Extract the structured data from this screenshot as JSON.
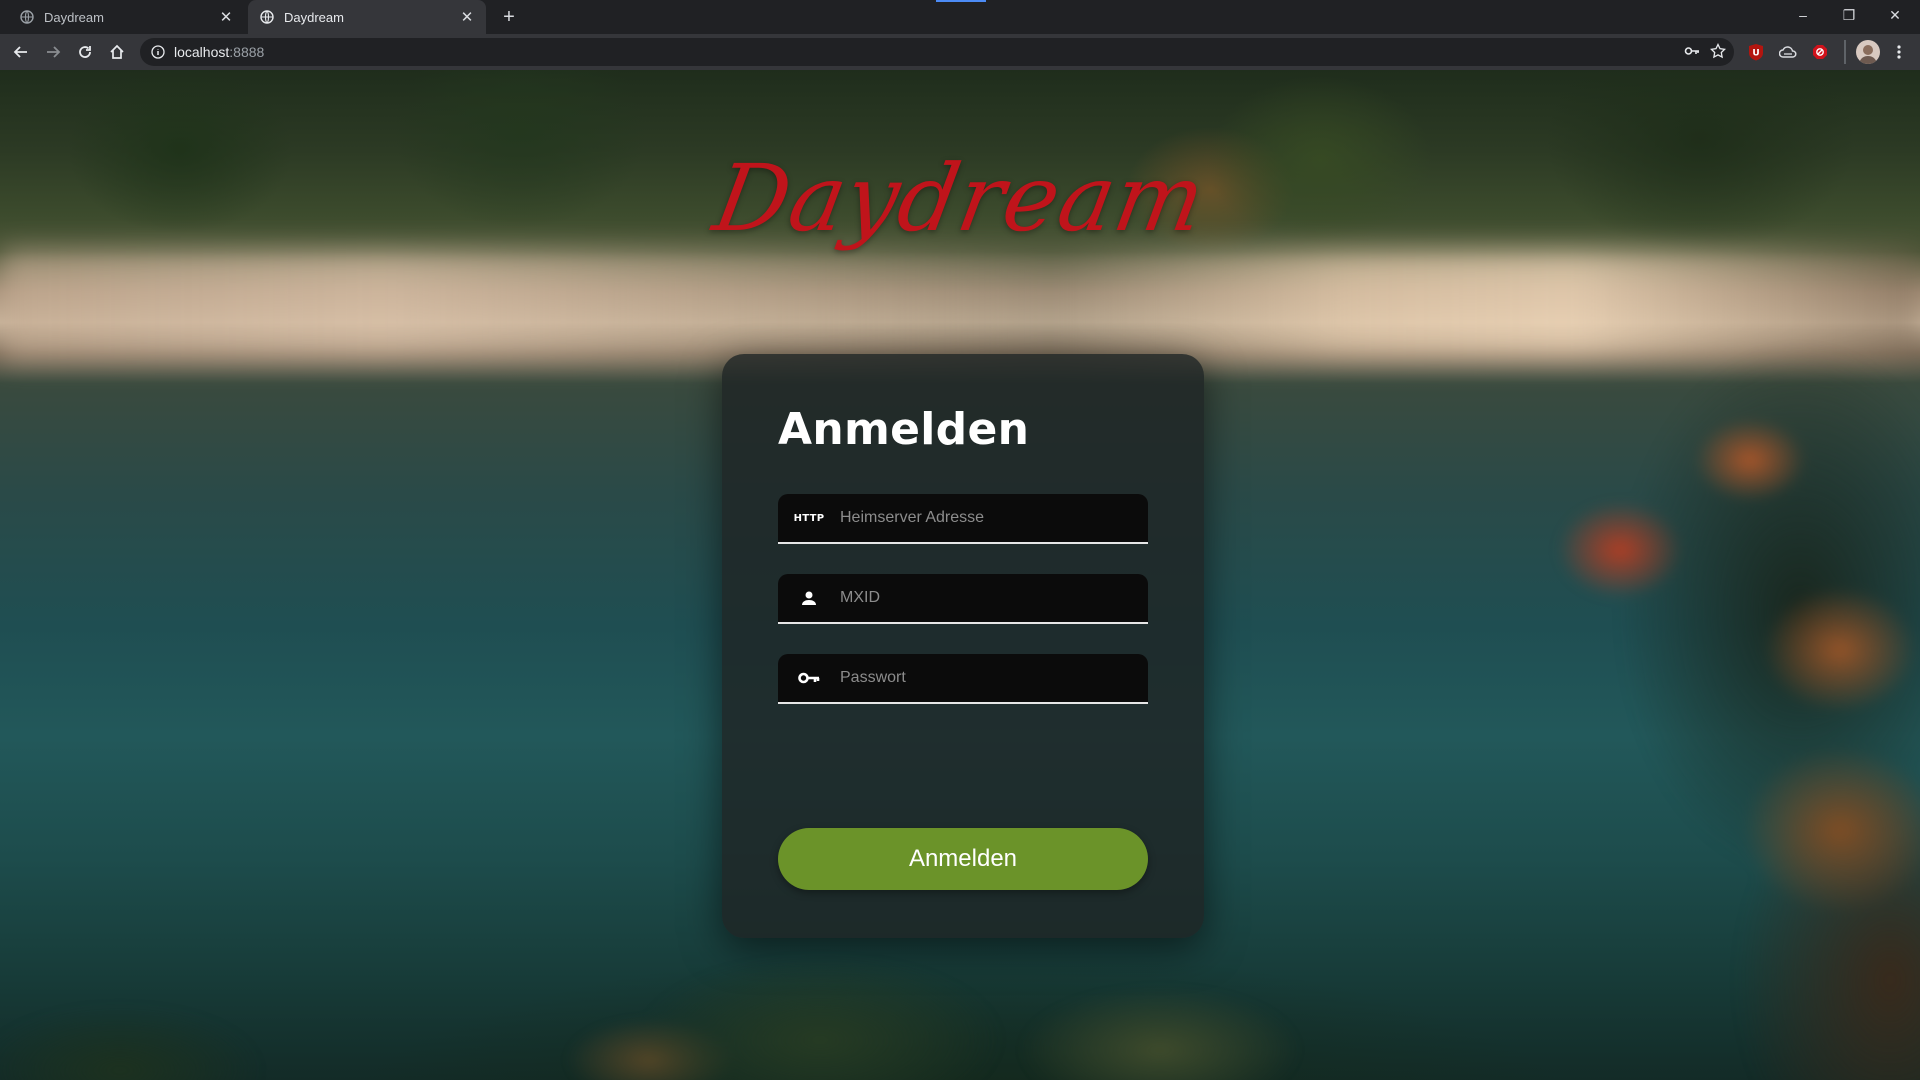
{
  "browser": {
    "tabs": [
      {
        "title": "Daydream",
        "active": false
      },
      {
        "title": "Daydream",
        "active": true
      }
    ],
    "new_tab_icon": "plus-icon",
    "url_host": "localhost",
    "url_port": ":8888",
    "window_controls": {
      "minimize": "–",
      "restore": "❐",
      "close": "✕"
    },
    "extensions": [
      "ublock-icon",
      "cloud-extension-icon",
      "adblock-icon"
    ]
  },
  "page": {
    "logo_text": "Daydream",
    "login": {
      "title": "Anmelden",
      "homeserver": {
        "icon_text": "HTTP",
        "placeholder": "Heimserver Adresse",
        "value": ""
      },
      "mxid": {
        "placeholder": "MXID",
        "value": ""
      },
      "password": {
        "placeholder": "Passwort",
        "value": ""
      },
      "submit_label": "Anmelden"
    },
    "colors": {
      "logo": "#c0141b",
      "button": "#6b9329",
      "card": "#1e2424"
    }
  }
}
